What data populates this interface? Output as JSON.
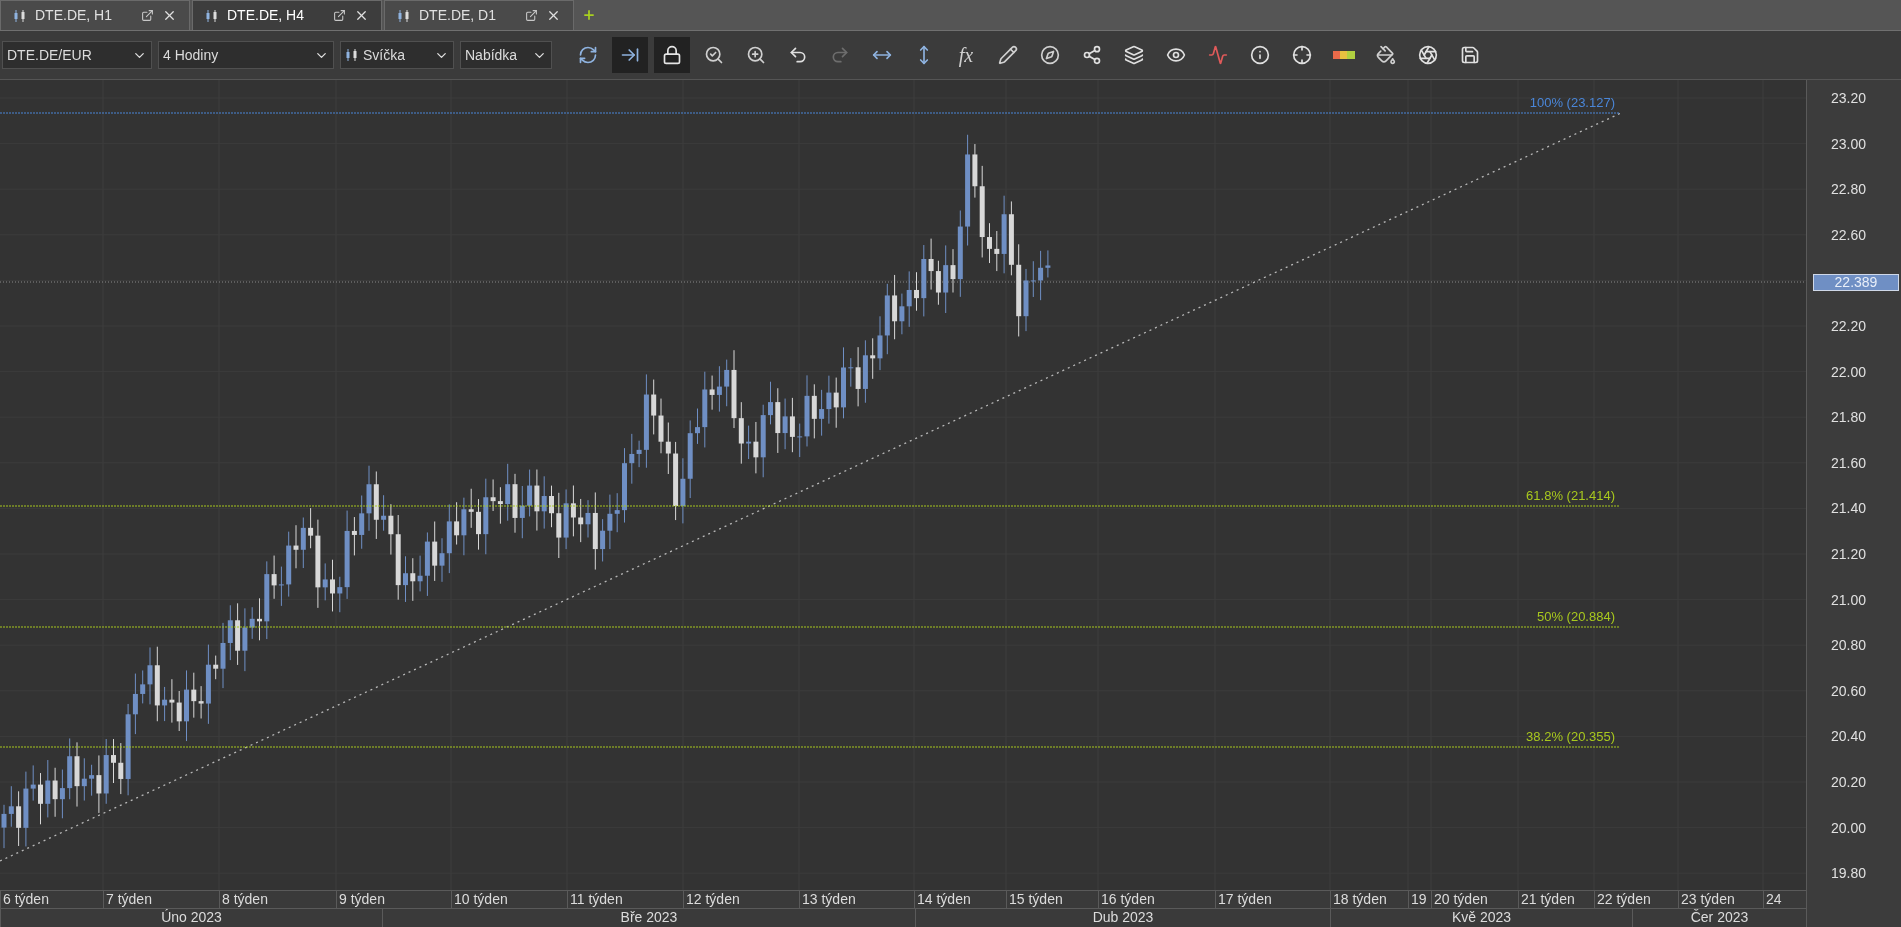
{
  "tabs": [
    {
      "label": "DTE.DE, H1",
      "selected": false
    },
    {
      "label": "DTE.DE, H4",
      "selected": true
    },
    {
      "label": "DTE.DE, D1",
      "selected": false
    }
  ],
  "toolbar": {
    "selects": [
      {
        "kind": "plain",
        "value": "DTE.DE/EUR"
      },
      {
        "kind": "plain",
        "value": "4 Hodiny"
      },
      {
        "kind": "candle",
        "value": "Svíčka"
      },
      {
        "kind": "plain",
        "value": "Nabídka"
      }
    ],
    "buttons": [
      {
        "kind": "refresh",
        "selected": false,
        "disabled": false
      },
      {
        "kind": "scroll",
        "selected": true,
        "disabled": false
      },
      {
        "kind": "lock",
        "selected": true,
        "disabled": false
      },
      {
        "kind": "zoomtime",
        "selected": false,
        "disabled": false
      },
      {
        "kind": "zoomrect",
        "selected": false,
        "disabled": false
      },
      {
        "kind": "undo",
        "selected": false,
        "disabled": false
      },
      {
        "kind": "redo",
        "selected": false,
        "disabled": true
      },
      {
        "kind": "hscale",
        "selected": false,
        "disabled": false
      },
      {
        "kind": "vscale",
        "selected": false,
        "disabled": false
      },
      {
        "kind": "text",
        "label": "fx",
        "selected": false,
        "disabled": false
      },
      {
        "kind": "pencil",
        "selected": false,
        "disabled": false
      },
      {
        "kind": "compass",
        "selected": false,
        "disabled": false
      },
      {
        "kind": "network",
        "selected": false,
        "disabled": false
      },
      {
        "kind": "layers",
        "selected": false,
        "disabled": false
      },
      {
        "kind": "eye",
        "selected": false,
        "disabled": false
      },
      {
        "kind": "indicator",
        "selected": false,
        "disabled": false
      },
      {
        "kind": "info",
        "selected": false,
        "disabled": false
      },
      {
        "kind": "crosshair",
        "selected": false,
        "disabled": false
      },
      {
        "kind": "colorbar",
        "selected": false,
        "disabled": false
      },
      {
        "kind": "bucket",
        "selected": false,
        "disabled": false
      },
      {
        "kind": "aperture",
        "selected": false,
        "disabled": false
      },
      {
        "kind": "save",
        "selected": false,
        "disabled": false
      }
    ]
  },
  "chart": {
    "fib_levels": [
      {
        "label": "100% (23.127)",
        "color": "#4a86d8"
      },
      {
        "label": "61.8% (21.414)",
        "color": "#a8c81e"
      },
      {
        "label": "50% (20.884)",
        "color": "#a8c81e"
      },
      {
        "label": "38.2% (20.355)",
        "color": "#a8c81e"
      }
    ],
    "price_ticks": [
      "23.20",
      "23.00",
      "22.80",
      "22.60",
      "22.20",
      "22.00",
      "21.80",
      "21.60",
      "21.40",
      "21.20",
      "21.00",
      "20.80",
      "20.60",
      "20.40",
      "20.20",
      "20.00",
      "19.80"
    ],
    "current_price": "22.389",
    "weeks": [
      "6 týden",
      "7 týden",
      "8 týden",
      "9 týden",
      "10 týden",
      "11 týden",
      "12 týden",
      "13 týden",
      "14 týden",
      "15 týden",
      "16 týden",
      "17 týden",
      "18 týden",
      "19",
      "20 týden",
      "21 týden",
      "22 týden",
      "23 týden",
      "24"
    ],
    "months": [
      "Úno 2023",
      "Bře 2023",
      "Dub 2023",
      "Kvě 2023",
      "Čer 2023"
    ]
  }
}
